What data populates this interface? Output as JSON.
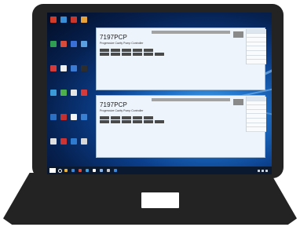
{
  "panel_title": "7197PCP",
  "panel_subtitle": "Progressive Cavity Pump Controller",
  "top_button": "",
  "action_buttons_row1": [
    "",
    "",
    "",
    "",
    ""
  ],
  "action_buttons_row2": [
    "",
    "",
    "",
    "",
    "",
    ""
  ],
  "status_table": {
    "headers": [
      "",
      ""
    ],
    "rows": [
      [
        "",
        ""
      ],
      [
        "",
        ""
      ],
      [
        "",
        ""
      ],
      [
        "",
        ""
      ],
      [
        "",
        ""
      ],
      [
        "",
        ""
      ],
      [
        "",
        ""
      ]
    ]
  },
  "desktop_icons": [
    {
      "label": "",
      "color": "#d23a2a"
    },
    {
      "label": "",
      "color": "#3a8ed6"
    },
    {
      "label": "",
      "color": "#c8362c"
    },
    {
      "label": "",
      "color": "#e8a23a"
    },
    {
      "label": "",
      "color": "#2f9d52"
    },
    {
      "label": "",
      "color": "#d84a3a"
    },
    {
      "label": "",
      "color": "#3a6fd6"
    },
    {
      "label": "",
      "color": "#5aa0e0"
    },
    {
      "label": "",
      "color": "#d43a3a"
    },
    {
      "label": "",
      "color": "#f0f0f0"
    },
    {
      "label": "",
      "color": "#3b7bd4"
    },
    {
      "label": "",
      "color": "#2d2d2d"
    },
    {
      "label": "",
      "color": "#3a9bd8"
    },
    {
      "label": "",
      "color": "#4db04d"
    },
    {
      "label": "",
      "color": "#e6e6e6"
    },
    {
      "label": "",
      "color": "#d53b3b"
    },
    {
      "label": "",
      "color": "#2a6fc2"
    },
    {
      "label": "",
      "color": "#c23030"
    },
    {
      "label": "",
      "color": "#f4f4f4"
    },
    {
      "label": "",
      "color": "#3a80d2"
    },
    {
      "label": "",
      "color": "#e0e0e0"
    },
    {
      "label": "",
      "color": "#cc3333"
    },
    {
      "label": "",
      "color": "#2e7bcf"
    },
    {
      "label": "",
      "color": "#d8d8d8"
    }
  ],
  "taskbar": {
    "items": [
      {
        "label": "",
        "color": "#e8b23a"
      },
      {
        "label": "",
        "color": "#3a86d8"
      },
      {
        "label": "",
        "color": "#d84a3a"
      },
      {
        "label": "",
        "color": "#3aa0e0"
      },
      {
        "label": "",
        "color": "#ffffff"
      },
      {
        "label": "",
        "color": "#8ab4e8"
      },
      {
        "label": "",
        "color": "#c8c8c8"
      },
      {
        "label": "",
        "color": "#3a86d8"
      }
    ],
    "clock": ""
  },
  "colors": {
    "laptop_body": "#232323",
    "window_bg": "#eef4fb",
    "button_bg": "#4a4a4a"
  }
}
